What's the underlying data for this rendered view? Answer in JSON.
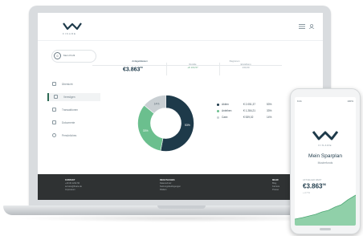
{
  "app": {
    "brand_text": "FINARE",
    "colors": {
      "navy": "#1e3a4a",
      "green": "#6bbf8e",
      "grey": "#c9cfd3",
      "footer": "#2f3233"
    }
  },
  "header": {
    "icons": [
      "bars-icon",
      "user-icon"
    ]
  },
  "sidebar": {
    "profile_name": "Mein Profil",
    "items": [
      {
        "label": "Übersicht",
        "icon": "grid-icon",
        "active": false
      },
      {
        "label": "Vermögen",
        "icon": "wallet-icon",
        "active": true
      },
      {
        "label": "Transaktionen",
        "icon": "list-icon",
        "active": false
      },
      {
        "label": "Dokumente",
        "icon": "doc-icon",
        "active": false
      },
      {
        "label": "Persönliches",
        "icon": "person-icon",
        "active": false
      }
    ]
  },
  "stats": {
    "total_value": "€3.863",
    "total_sup": "56",
    "secondary": [
      {
        "label": "Rendite",
        "value": "+€ 104,57"
      },
      {
        "label": "Einzahlung",
        "value": "130,00"
      }
    ]
  },
  "tabs": [
    {
      "label": "Anlageklassen",
      "active": true
    },
    {
      "label": "Regionen",
      "active": false
    }
  ],
  "chart_data": {
    "type": "pie",
    "labels": [
      "Aktien",
      "Anleihen",
      "Cash"
    ],
    "values": [
      53,
      33,
      14
    ],
    "colors": [
      "#1e3a4a",
      "#6bbf8e",
      "#c9cfd3"
    ],
    "slice_labels": [
      "53%",
      "33%",
      "14%"
    ],
    "legend": [
      {
        "name": "Aktien",
        "value": "€ 2.051,37",
        "pct": "53%"
      },
      {
        "name": "Anleihen",
        "value": "€ 1.284,21",
        "pct": "33%"
      },
      {
        "name": "Cash",
        "value": "€ 539,02",
        "pct": "14%"
      }
    ]
  },
  "footer": {
    "columns": [
      {
        "heading": "KONTAKT",
        "lines": [
          "+49 30 1234 56",
          "service@finare.de",
          "Impressum"
        ]
      },
      {
        "heading": "RECHTLICHES",
        "lines": [
          "Datenschutz",
          "Nutzungsbedingungen",
          "Risiken"
        ]
      },
      {
        "heading": "MEHR",
        "lines": [
          "Blog",
          "Karriere",
          "Presse"
        ]
      }
    ]
  },
  "phone": {
    "status_left": "9:41",
    "status_right": "100%",
    "brand_text": "FINARE",
    "title": "Mein Sparplan",
    "subtitle": "Musterfonds",
    "value_label": "AKTUELLER WERT",
    "value": "€3.863",
    "value_sup": "56",
    "value_sub": "+ 2,7 %"
  }
}
